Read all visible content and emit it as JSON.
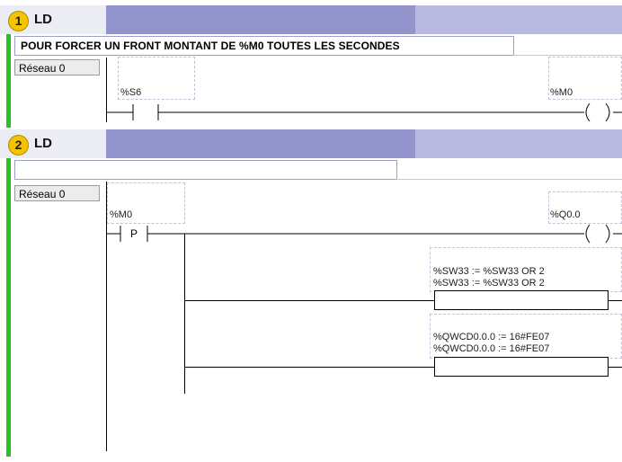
{
  "sections": [
    {
      "number": "1",
      "language": "LD",
      "comment": "POUR FORCER UN FRONT MONTANT DE %M0 TOUTES LES SECONDES",
      "network_label": "Réseau 0",
      "contact_var": "%S6",
      "coil_var": "%M0"
    },
    {
      "number": "2",
      "language": "LD",
      "comment": "",
      "network_label": "Réseau 0",
      "contact_var": "%M0",
      "contact_symbol": "P",
      "coil_var": "%Q0.0",
      "operation_blocks": [
        {
          "line1": "%SW33 := %SW33 OR 2",
          "line2": "%SW33 := %SW33 OR 2"
        },
        {
          "line1": "%QWCD0.0.0 := 16#FE07",
          "line2": "%QWCD0.0.0 := 16#FE07"
        }
      ]
    }
  ],
  "colors": {
    "left_bar": "#22c322",
    "header_mid": "#9494cc",
    "header_right": "#b8b8e0",
    "badge": "#f5c400"
  }
}
